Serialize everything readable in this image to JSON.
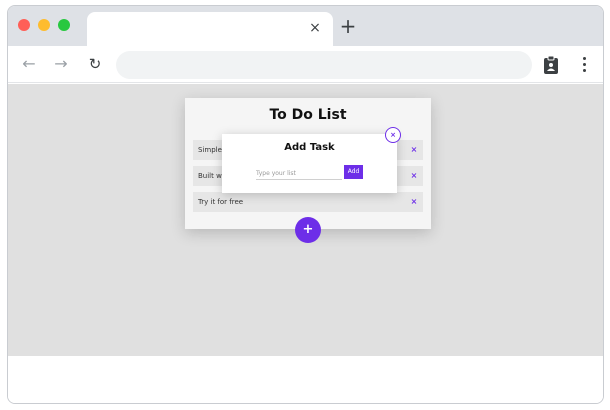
{
  "browser": {
    "tab_close_glyph": "×",
    "new_tab_glyph": "+",
    "back_glyph": "←",
    "forward_glyph": "→",
    "reload_glyph": "↻",
    "address_value": "",
    "icons": [
      "close-icon",
      "plus-icon",
      "back-arrow-icon",
      "forward-arrow-icon",
      "reload-icon",
      "clipboard-icon",
      "kebab-menu-icon"
    ]
  },
  "todo": {
    "title": "To Do List",
    "tasks": [
      {
        "label": "Simple"
      },
      {
        "label": "Built wi"
      },
      {
        "label": "Try it for free"
      }
    ],
    "delete_glyph": "×",
    "add_fab_glyph": "+"
  },
  "modal": {
    "title": "Add Task",
    "input_placeholder": "Type your list",
    "input_value": "",
    "add_button_label": "Add",
    "close_glyph": "×"
  },
  "colors": {
    "accent": "#6d2ee8",
    "viewport_bg": "#e0e0e0",
    "tabstrip_bg": "#dee1e6"
  }
}
